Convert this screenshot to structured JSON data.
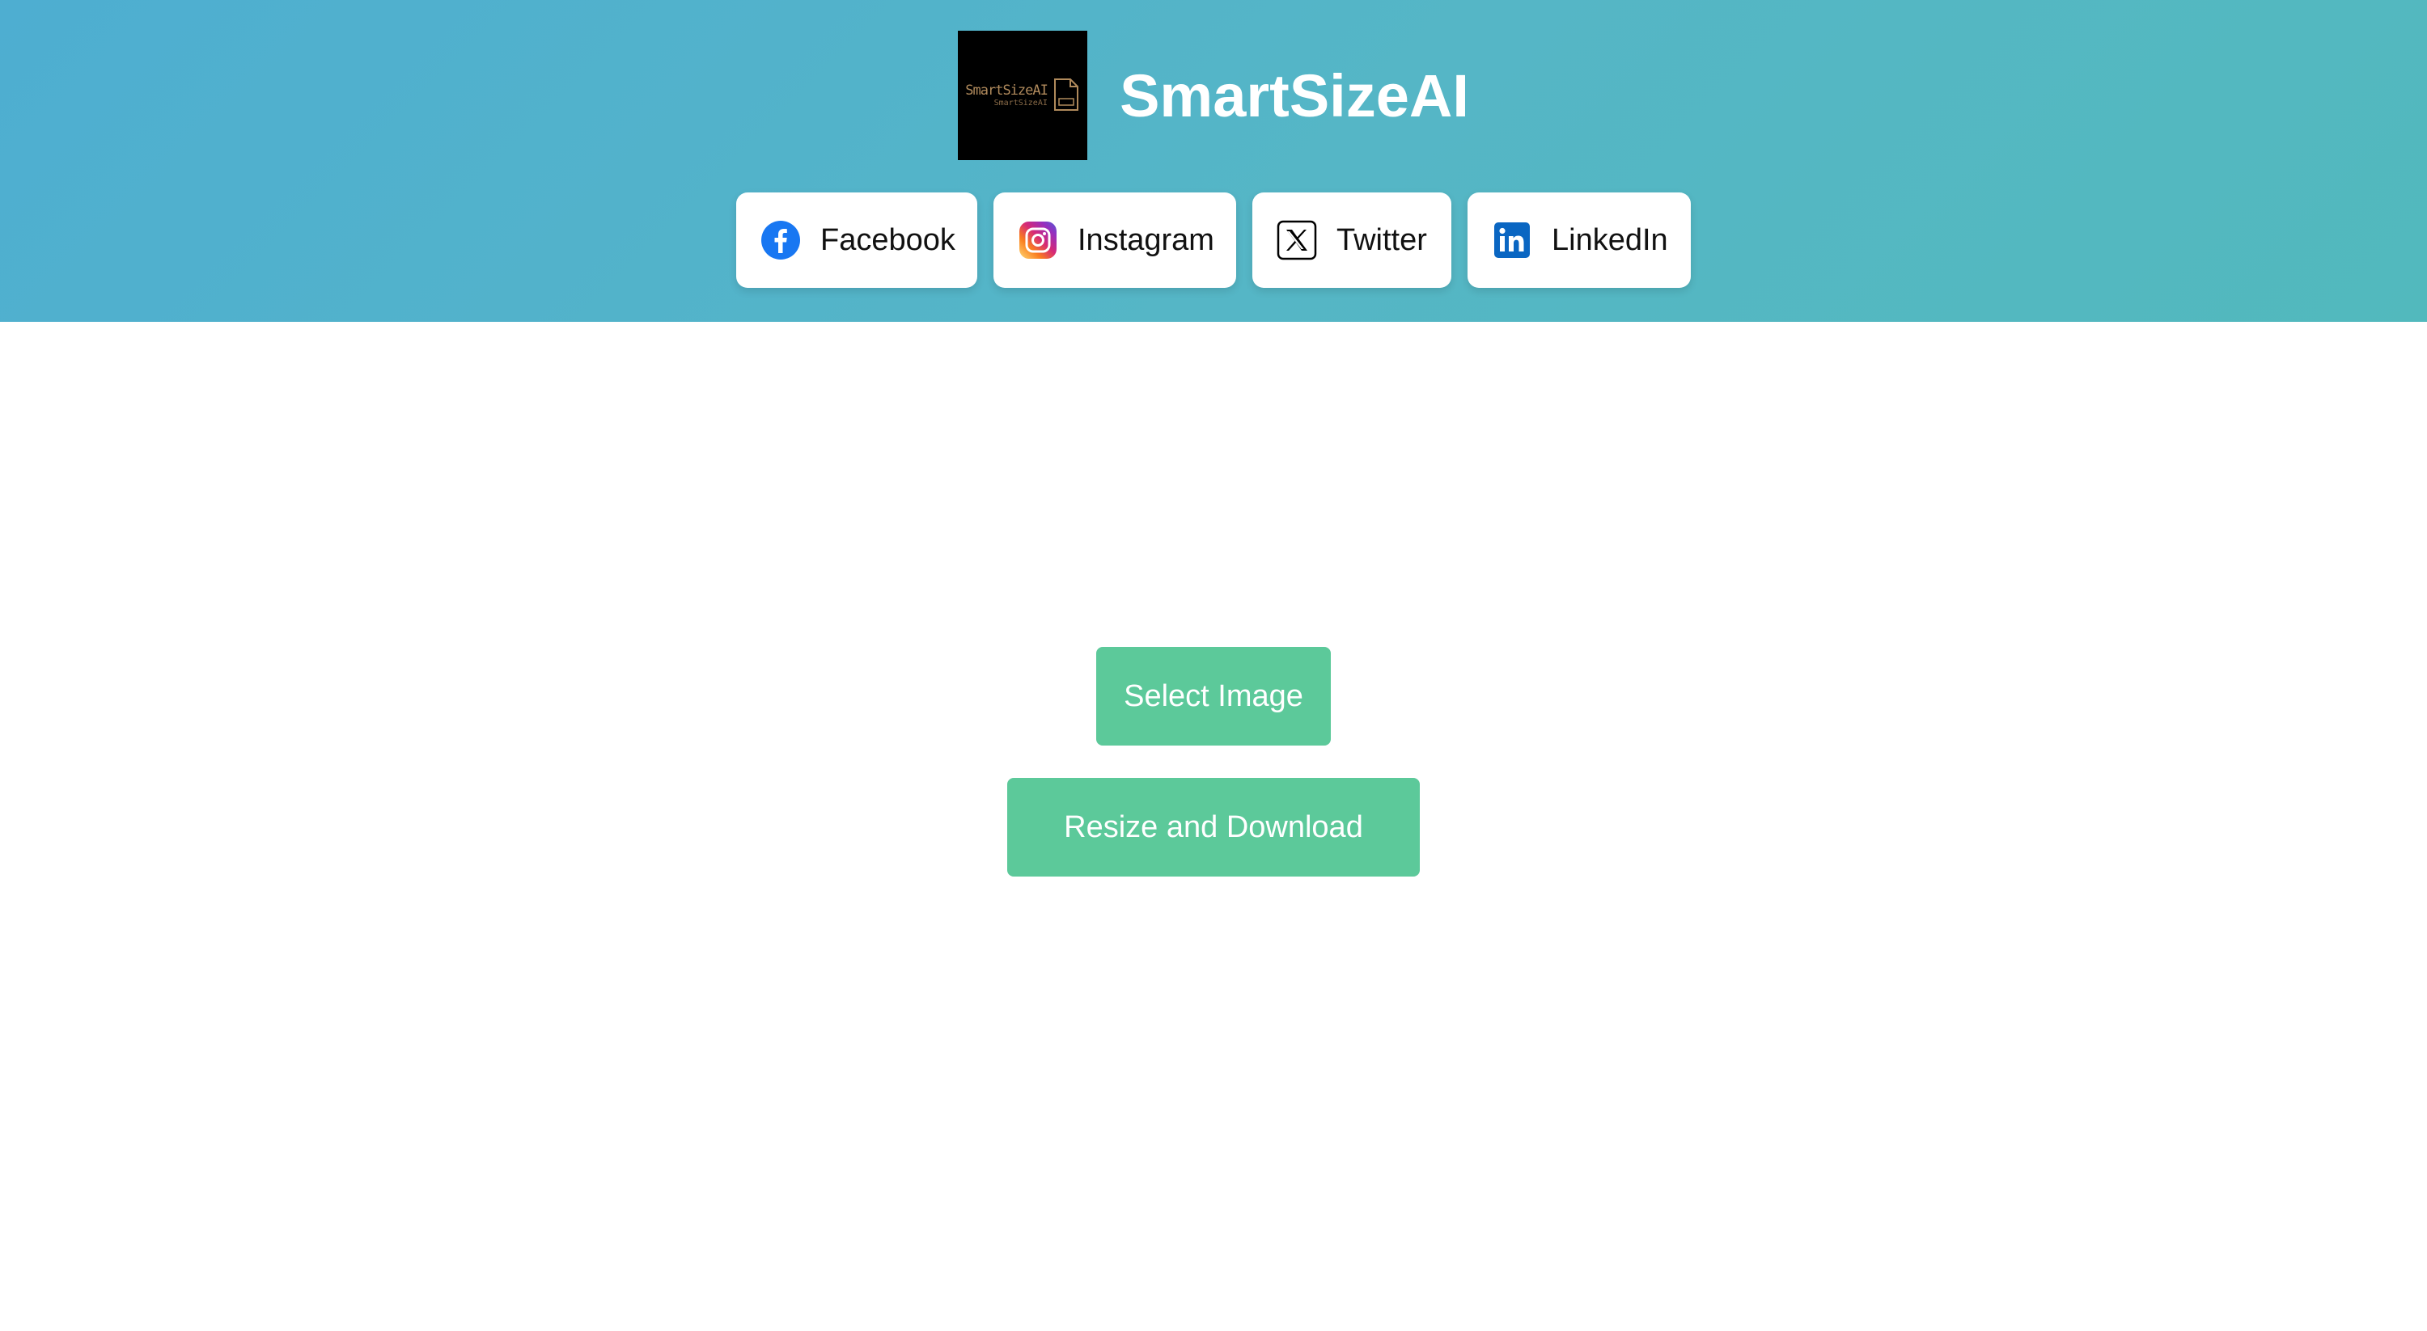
{
  "header": {
    "title": "SmartSizeAI",
    "logo": {
      "line1": "SmartSizeAI",
      "line2": "SmartSizeAI"
    }
  },
  "social": [
    {
      "label": "Facebook",
      "icon": "facebook-icon",
      "color": "#1877f2"
    },
    {
      "label": "Instagram",
      "icon": "instagram-icon",
      "color": "#e1306c"
    },
    {
      "label": "Twitter",
      "icon": "x-icon",
      "color": "#000000"
    },
    {
      "label": "LinkedIn",
      "icon": "linkedin-icon",
      "color": "#0a66c2"
    }
  ],
  "actions": {
    "select_label": "Select Image",
    "resize_label": "Resize and Download"
  },
  "colors": {
    "header_start": "#4eaed1",
    "header_end": "#52b9bd",
    "button_green": "#5cc99a"
  }
}
